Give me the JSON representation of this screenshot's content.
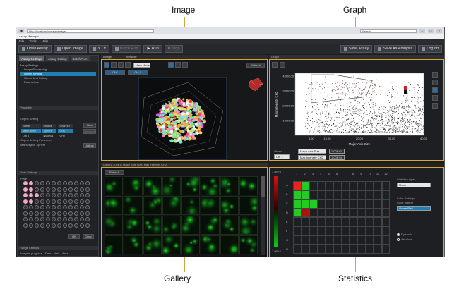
{
  "callouts": {
    "image": "Image",
    "graph": "Graph",
    "gallery": "Gallery",
    "statistics": "Statistics"
  },
  "browser": {
    "url": "http://localhost/assaymanager",
    "tab": "Assay Manager",
    "search": "Search..."
  },
  "menu": [
    "File",
    "Tools",
    "Help"
  ],
  "toolbar": {
    "open_assay": "Open Assay",
    "open_image": "Open Image",
    "view_3d": "3D",
    "batch_run": "Batch Run",
    "run": "Run",
    "stop": "Stop",
    "save_assay": "Save Assay",
    "save_as_analysis": "Save As Analysis",
    "log_off": "Log off"
  },
  "left_panel": {
    "tabs": [
      "Assay Settings",
      "Assay Gating",
      "Batch Run"
    ],
    "tree": [
      "Assay Settings",
      "Image Processing",
      "Object Setting",
      "Object Unit Setting",
      "Parameters"
    ],
    "properties_title": "Properties",
    "object_setting": "Object Setting",
    "table_headers": [
      "Name",
      "Module",
      "Channel"
    ],
    "table_rows": [
      [
        "MainObject",
        "Sphere",
        "CH1"
      ],
      [
        "Obj 1",
        "Nucleus",
        "CH2"
      ]
    ],
    "buttons": {
      "new": "New",
      "remove": "Remove",
      "adjust": "Adjust"
    },
    "param_title": "Object Setting Parameter",
    "param_value": "MainObject: Sphere",
    "plate_title": "Plate Settings",
    "plate_label": "Plate",
    "ok": "OK",
    "clear": "Clear",
    "range_title": "Range Settings",
    "progress_labels": [
      "Analysis progress",
      "Time",
      "Well",
      "Area"
    ]
  },
  "image_panel": {
    "tabs": [
      "Image",
      "Volume"
    ],
    "view_select": "View Mode",
    "refresh": "Refresh",
    "buttons": [
      "CH1",
      "Obj 1"
    ]
  },
  "graph_panel": {
    "title": "Graph",
    "object_label": "Object",
    "object_select": "Obj 1",
    "x_select": "Major Axis Size",
    "y_select": "Max Intensity CH2",
    "x_val": "1.00E+2",
    "y_val": "1.00E+4"
  },
  "gallery_panel": {
    "title": "Gallery - Obj 1: Major Axis Size, Max Intensity CH2",
    "refresh": "Refresh"
  },
  "stats_panel": {
    "scale_top": "7.5E+4",
    "scale_bottom": "1.0E+4",
    "statistics_type_label": "Statistics type",
    "statistics_type_value": "Mean",
    "color_settings_label": "Color Settings",
    "color_pattern_label": "Color pattern",
    "color_pattern_value": "Green Red",
    "radio_dynamic": "Dynamic",
    "radio_absolute": "Absolute",
    "columns": [
      "1",
      "2",
      "3",
      "4",
      "5",
      "6",
      "7",
      "8",
      "9",
      "10",
      "11",
      "12"
    ],
    "rows": [
      "A",
      "B",
      "C",
      "D",
      "E",
      "F",
      "G",
      "H"
    ]
  },
  "chart_data": {
    "type": "scatter",
    "title": "",
    "xlabel": "Major Axis Size",
    "ylabel": "Max Intensity CH2",
    "xlim": [
      0,
      40
    ],
    "ylim": [
      0,
      4200
    ],
    "xticks": [
      "5.00",
      "10.00",
      "20.00",
      "30.00",
      "40.00"
    ],
    "yticks": [
      "1 000.00",
      "2 000.00",
      "3 000.00",
      "4 000.00"
    ],
    "series": [
      {
        "color": "#111111",
        "density": "high",
        "range_x": [
          3,
          40
        ],
        "range_y": [
          200,
          3600
        ]
      },
      {
        "color": "#cc2222",
        "density": "low",
        "range_x": [
          8,
          26
        ],
        "range_y": [
          2000,
          4100
        ]
      }
    ],
    "gate_polygon": [
      [
        5,
        2200
      ],
      [
        5,
        4100
      ],
      [
        12,
        4100
      ],
      [
        24,
        3700
      ],
      [
        22,
        2600
      ]
    ],
    "grid": false
  }
}
